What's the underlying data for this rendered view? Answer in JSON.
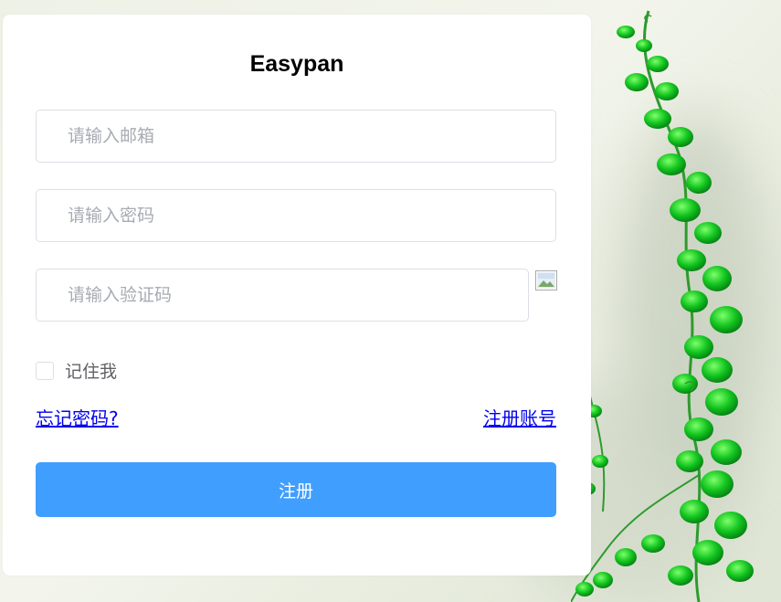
{
  "app": {
    "title": "Easypan"
  },
  "form": {
    "email_placeholder": "请输入邮箱",
    "password_placeholder": "请输入密码",
    "captcha_placeholder": "请输入验证码",
    "remember_label": "记住我",
    "forgot_link": "忘记密码?",
    "register_link": "注册账号",
    "submit_label": "注册"
  },
  "colors": {
    "primary": "#409eff",
    "link": "#0000ee",
    "leaf_green": "#1fbf2a",
    "card_bg": "#ffffff"
  },
  "icons": {
    "captcha_image": "broken-image-icon",
    "background": "green-vine-leaves"
  }
}
